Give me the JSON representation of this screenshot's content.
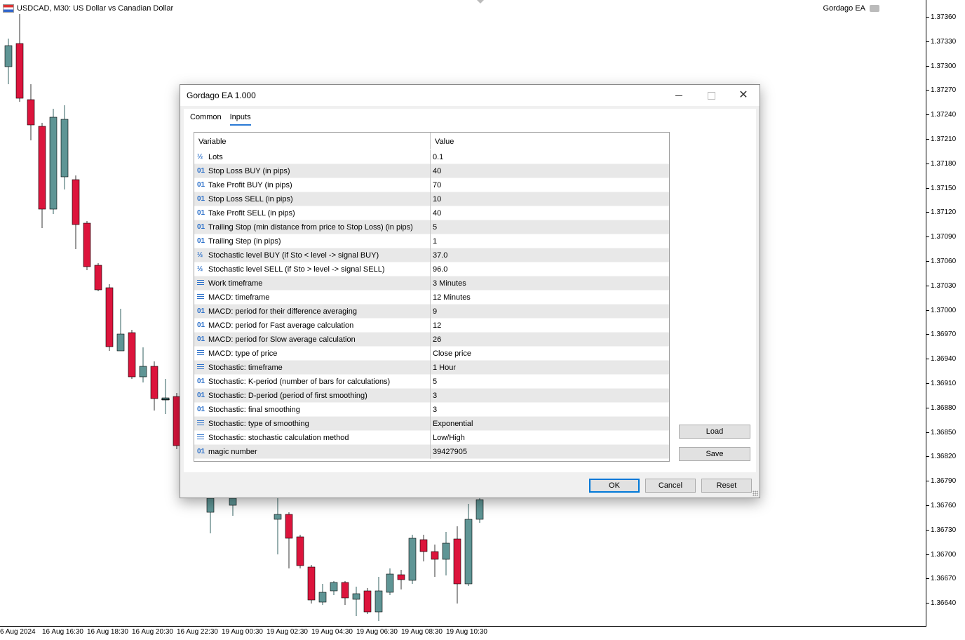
{
  "chart": {
    "symbol_title": "USDCAD, M30:  US Dollar vs Canadian Dollar",
    "ea_label": "Gordago EA",
    "price_ticks": [
      "1.37360",
      "1.37330",
      "1.37300",
      "1.37270",
      "1.37240",
      "1.37210",
      "1.37180",
      "1.37150",
      "1.37120",
      "1.37090",
      "1.37060",
      "1.37030",
      "1.37000",
      "1.36970",
      "1.36940",
      "1.36910",
      "1.36880",
      "1.36850",
      "1.36820",
      "1.36790",
      "1.36760",
      "1.36730",
      "1.36700",
      "1.36670",
      "1.36640"
    ],
    "time_ticks": [
      "6 Aug 2024",
      "16 Aug 16:30",
      "16 Aug 18:30",
      "16 Aug 20:30",
      "16 Aug 22:30",
      "19 Aug 00:30",
      "19 Aug 02:30",
      "19 Aug 04:30",
      "19 Aug 06:30",
      "19 Aug 08:30",
      "19 Aug 10:30"
    ],
    "colors": {
      "bull": "#5f9595",
      "bear": "#dc143c"
    }
  },
  "dialog": {
    "title": "Gordago EA 1.000",
    "tabs": [
      {
        "label": "Common"
      },
      {
        "label": "Inputs"
      }
    ],
    "columns": {
      "variable": "Variable",
      "value": "Value"
    },
    "rows": [
      {
        "icon": "½",
        "type": "double",
        "variable": "Lots",
        "value": "0.1"
      },
      {
        "icon": "01",
        "type": "int",
        "variable": "Stop Loss BUY (in pips)",
        "value": "40"
      },
      {
        "icon": "01",
        "type": "int",
        "variable": "Take Profit BUY (in pips)",
        "value": "70"
      },
      {
        "icon": "01",
        "type": "int",
        "variable": "Stop Loss SELL (in pips)",
        "value": "10"
      },
      {
        "icon": "01",
        "type": "int",
        "variable": "Take Profit SELL (in pips)",
        "value": "40"
      },
      {
        "icon": "01",
        "type": "int",
        "variable": "Trailing Stop (min distance from price to Stop Loss) (in pips)",
        "value": "5"
      },
      {
        "icon": "01",
        "type": "int",
        "variable": "Trailing Step (in pips)",
        "value": "1"
      },
      {
        "icon": "½",
        "type": "double",
        "variable": "Stochastic level BUY (if Sto < level -> signal BUY)",
        "value": "37.0"
      },
      {
        "icon": "½",
        "type": "double",
        "variable": "Stochastic level SELL (if Sto > level -> signal SELL)",
        "value": "96.0"
      },
      {
        "icon": "",
        "type": "enum",
        "variable": "Work timeframe",
        "value": "3 Minutes"
      },
      {
        "icon": "",
        "type": "enum",
        "variable": "MACD: timeframe",
        "value": "12 Minutes"
      },
      {
        "icon": "01",
        "type": "int",
        "variable": "MACD: period for their difference averaging",
        "value": "9"
      },
      {
        "icon": "01",
        "type": "int",
        "variable": "MACD: period for Fast average calculation",
        "value": "12"
      },
      {
        "icon": "01",
        "type": "int",
        "variable": "MACD: period for Slow average calculation",
        "value": "26"
      },
      {
        "icon": "",
        "type": "enum",
        "variable": "MACD: type of price",
        "value": "Close price"
      },
      {
        "icon": "",
        "type": "enum",
        "variable": "Stochastic: timeframe",
        "value": "1 Hour"
      },
      {
        "icon": "01",
        "type": "int",
        "variable": "Stochastic: K-period (number of bars for calculations)",
        "value": "5"
      },
      {
        "icon": "01",
        "type": "int",
        "variable": "Stochastic: D-period (period of first smoothing)",
        "value": "3"
      },
      {
        "icon": "01",
        "type": "int",
        "variable": "Stochastic: final smoothing",
        "value": "3"
      },
      {
        "icon": "",
        "type": "enum",
        "variable": "Stochastic: type of smoothing",
        "value": "Exponential"
      },
      {
        "icon": "",
        "type": "enum",
        "variable": "Stochastic: stochastic calculation method",
        "value": "Low/High"
      },
      {
        "icon": "01",
        "type": "int",
        "variable": "magic number",
        "value": "39427905"
      }
    ],
    "buttons": {
      "load": "Load",
      "save": "Save",
      "ok": "OK",
      "cancel": "Cancel",
      "reset": "Reset"
    }
  }
}
